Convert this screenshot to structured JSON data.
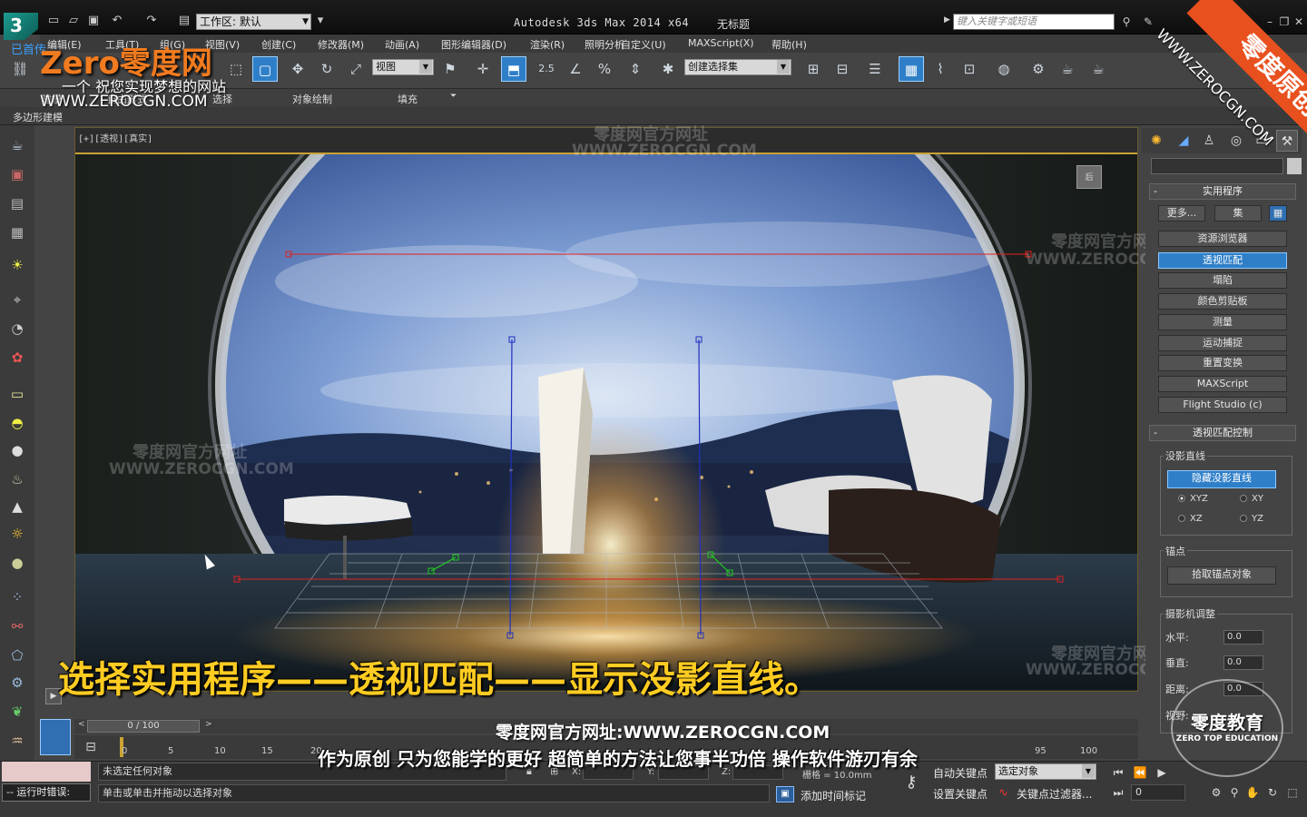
{
  "titlebar": {
    "workspace": "工作区: 默认",
    "app_title": "Autodesk 3ds Max  2014 x64",
    "doc_title": "无标题",
    "search_placeholder": "键入关键字或短语"
  },
  "menu": [
    "编辑(E)",
    "工具(T)",
    "组(G)",
    "视图(V)",
    "创建(C)",
    "修改器(M)",
    "动画(A)",
    "图形编辑器(D)",
    "渲染(R)",
    "照明分析",
    "自定义(U)",
    "MAXScript(X)",
    "帮助(H)"
  ],
  "toolbar": {
    "view_combo": "视图",
    "snap_value": "2.5",
    "selection_set": "创建选择集"
  },
  "ribbon": {
    "tabs": [
      "建模",
      "自由形式",
      "选择",
      "对象绘制",
      "填充"
    ],
    "sub": "多边形建模"
  },
  "viewport": {
    "label": "[+][透视][真实]",
    "viewcube": "后"
  },
  "scene": {
    "sky_color": "#5d7fc0",
    "floor_color": "#1e2a33",
    "vanish_line_color": "#e02020",
    "vert_line_color": "#2030c0",
    "handle_color": "#22cc22"
  },
  "subtitle": "选择实用程序——透视匹配——显示没影直线。",
  "command_panel": {
    "utilities_title": "实用程序",
    "more_button": "更多...",
    "sets_button": "集",
    "utilities": [
      "资源浏览器",
      "透视匹配",
      "塌陷",
      "颜色剪贴板",
      "测量",
      "运动捕捉",
      "重置变换",
      "MAXScript",
      "Flight Studio (c)"
    ],
    "selected_utility": "透视匹配",
    "pm_title": "透视匹配控制",
    "vanish_group": "没影直线",
    "hide_lines_button": "隐藏没影直线",
    "axes": [
      "XYZ",
      "XY",
      "XZ",
      "YZ"
    ],
    "axis_selected": "XYZ",
    "anchor_group": "锚点",
    "pick_anchor_button": "拾取锚点对象",
    "camera_group": "摄影机调整",
    "horizontal_label": "水平:",
    "horizontal_value": "0.0",
    "vertical_label": "垂直:",
    "vertical_value": "0.0",
    "distance_label": "距离:",
    "distance_value": "0.0",
    "fov_label": "视野:"
  },
  "timeline": {
    "frame": "0 / 100",
    "ticks": [
      "0",
      "5",
      "10",
      "15",
      "20",
      "95",
      "100"
    ]
  },
  "status": {
    "maxscript_label": "-- 运行时错误:",
    "selection": "未选定任何对象",
    "prompt": "单击或单击并拖动以选择对象",
    "x_label": "X:",
    "y_label": "Y:",
    "z_label": "Z:",
    "grid": "栅格 = 10.0mm",
    "add_time_tag": "添加时间标记",
    "auto_key": "自动关键点",
    "set_key": "设置关键点",
    "selected_object": "选定对象",
    "key_filters": "关键点过滤器...",
    "frame_field": "0"
  },
  "watermarks": {
    "logo": "Zero零度网",
    "already": "已首传",
    "slogan": "一个 祝您实现梦想的网站",
    "url": "WWW.ZEROCGN.COM",
    "corner": "零度原创",
    "corner_url": "WWW.ZEROCGN.COM",
    "official": "零度网官方网址",
    "official_url": "WWW.ZEROCGN.COM",
    "banner_url": "零度网官方网址:WWW.ZEROCGN.COM",
    "banner_slogan": "作为原创 只为您能学的更好 超简单的方法让您事半功倍 操作软件游刃有余",
    "seal_title": "零度教育",
    "seal_sub": "ZERO TOP EDUCATION"
  }
}
